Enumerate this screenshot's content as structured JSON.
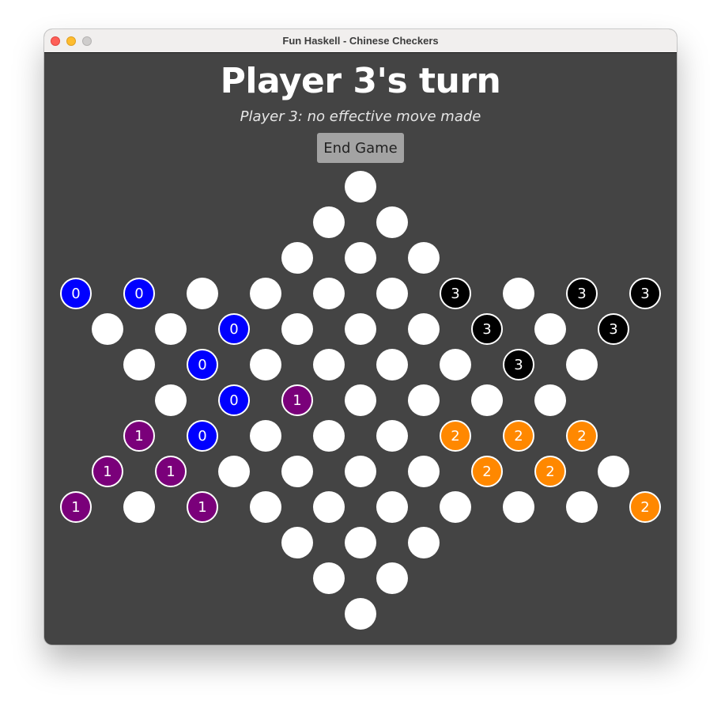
{
  "window": {
    "title": "Fun Haskell - Chinese Checkers"
  },
  "game": {
    "heading": "Player 3's turn",
    "status": "Player 3: no effective move made",
    "end_button": "End Game"
  },
  "colors": {
    "empty": "#ffffff",
    "player_0": "#0000ff",
    "player_1": "#7a007a",
    "player_2": "#ff8800",
    "player_3": "#000000"
  },
  "board": {
    "rows": [
      [
        "-"
      ],
      [
        "-",
        "-"
      ],
      [
        "-",
        "-",
        "-"
      ],
      [
        "0",
        "0",
        "-",
        "-",
        "-",
        "-",
        "3",
        "-",
        "3",
        "3"
      ],
      [
        "-",
        "-",
        "0",
        "-",
        "-",
        "-",
        "3",
        "-",
        "3"
      ],
      [
        "-",
        "0",
        "-",
        "-",
        "-",
        "-",
        "3",
        "-"
      ],
      [
        "-",
        "0",
        "1",
        "-",
        "-",
        "-",
        "-"
      ],
      [
        "1",
        "0",
        "-",
        "-",
        "-",
        "2",
        "2",
        "2"
      ],
      [
        "1",
        "1",
        "-",
        "-",
        "-",
        "-",
        "2",
        "2",
        "-"
      ],
      [
        "1",
        "-",
        "1",
        "-",
        "-",
        "-",
        "-",
        "-",
        "-",
        "2"
      ],
      [
        "-",
        "-",
        "-"
      ],
      [
        "-",
        "-"
      ],
      [
        "-"
      ]
    ]
  }
}
